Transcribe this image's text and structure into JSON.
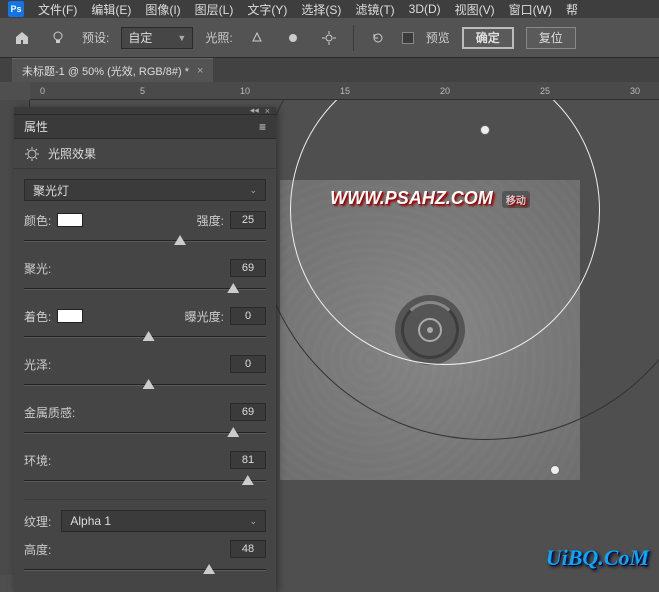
{
  "menu": {
    "items": [
      "文件(F)",
      "编辑(E)",
      "图像(I)",
      "图层(L)",
      "文字(Y)",
      "选择(S)",
      "滤镜(T)",
      "3D(D)",
      "视图(V)",
      "窗口(W)",
      "帮"
    ]
  },
  "optbar": {
    "preset_label": "预设:",
    "preset_value": "自定",
    "light_label": "光照:",
    "preview_label": "预览",
    "ok": "确定",
    "reset": "复位"
  },
  "doc": {
    "tab": "未标题-1 @ 50% (光效, RGB/8#) *"
  },
  "ruler": {
    "marks": [
      "0",
      "5",
      "10",
      "15",
      "20",
      "25",
      "30"
    ]
  },
  "canvas": {
    "url_text": "WWW.PSAHZ.COM",
    "url_badge": "移动"
  },
  "panel": {
    "title": "属性",
    "section": "光照效果",
    "light_type": "聚光灯",
    "color_label": "颜色:",
    "intensity_label": "强度:",
    "intensity_value": "25",
    "hotspot_label": "聚光:",
    "hotspot_value": "69",
    "tint_label": "着色:",
    "exposure_label": "曝光度:",
    "exposure_value": "0",
    "gloss_label": "光泽:",
    "gloss_value": "0",
    "metallic_label": "金属质感:",
    "metallic_value": "69",
    "ambience_label": "环境:",
    "ambience_value": "81",
    "texture_label": "纹理:",
    "texture_value": "Alpha 1",
    "height_label": "高度:",
    "height_value": "48"
  },
  "watermark": "UiBQ.CoM"
}
